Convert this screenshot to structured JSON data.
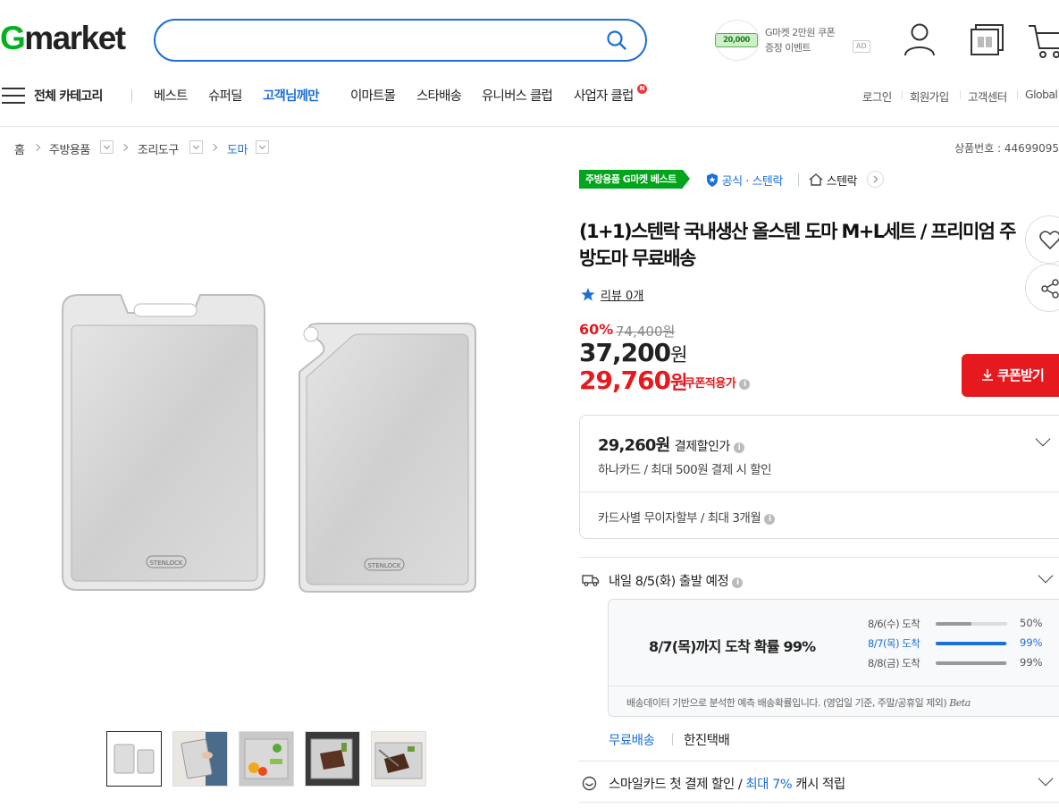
{
  "header": {
    "logo_g": "G",
    "logo_rest": "market",
    "search": {
      "value": "",
      "placeholder": ""
    },
    "ad": {
      "amount": "20,000",
      "line1": "G마켓 2만원 쿠폰",
      "line2": "증정 이벤트",
      "tag": "AD"
    },
    "icons": [
      "user-icon",
      "recent-items-icon",
      "cart-icon"
    ]
  },
  "nav": {
    "category_label": "전체 카테고리",
    "items": [
      {
        "label": "베스트",
        "highlight": false
      },
      {
        "label": "슈퍼딜",
        "highlight": false
      },
      {
        "label": "고객님께만",
        "highlight": true
      },
      {
        "label": "이마트몰",
        "highlight": false
      },
      {
        "label": "스타배송",
        "highlight": false
      },
      {
        "label": "유니버스 클럽",
        "highlight": false
      },
      {
        "label": "사업자 클럽",
        "highlight": false
      }
    ],
    "new_badge": "N",
    "utils": [
      "로그인",
      "회원가입",
      "고객센터",
      "Global"
    ]
  },
  "breadcrumb": {
    "items": [
      "홈",
      "주방용품",
      "조리도구",
      "도마"
    ],
    "product_no": "상품번호 : 44699095"
  },
  "gallery": {
    "brand_mark": "STENLOCK",
    "thumbnails": [
      "thumbnail-1",
      "thumbnail-2",
      "thumbnail-3",
      "thumbnail-4",
      "thumbnail-5"
    ],
    "selected_index": 0
  },
  "product": {
    "best_tag": "주방용품 G마켓 베스트",
    "official": "공식 · 스텐락",
    "store": "스텐락",
    "title": "(1+1)스텐락 국내생산 올스텐 도마 M+L세트 / 프리미엄 주방도마 무료배송",
    "review": "리뷰 0개",
    "discount": "60%",
    "original_price": "74,400원",
    "price_num": "37,200",
    "price_unit": "원",
    "coupon_price_num": "29,760",
    "coupon_price_unit": "원",
    "coupon_label": "쿠폰적용가",
    "coupon_button": "쿠폰받기"
  },
  "payment": {
    "amount": "29,260원",
    "amount_label": "결제할인가",
    "desc": "하나카드 / 최대 500원 결제 시 할인",
    "installment": "카드사별 무이자할부 / 최대 3개월"
  },
  "shipping": {
    "depart": "내일 8/5(화) 출발 예정",
    "headline": "8/7(목)까지 도착 확률 99%",
    "rows": [
      {
        "label": "8/6(수) 도착",
        "pct": "50%",
        "value": 0.5,
        "highlight": false
      },
      {
        "label": "8/7(목) 도착",
        "pct": "99%",
        "value": 0.99,
        "highlight": true
      },
      {
        "label": "8/8(금) 도착",
        "pct": "99%",
        "value": 0.99,
        "highlight": false
      }
    ],
    "note": "배송데이터 기반으로 분석한 예측 배송확률입니다. (영업일 기준, 주말/공휴일 제외)",
    "beta": "Beta",
    "free": "무료배송",
    "carrier": "한진택배"
  },
  "smile": {
    "prefix": "스마일카드 첫 결제 할인 / ",
    "highlight": "최대 7%",
    "suffix": " 캐시 적립"
  },
  "colors": {
    "brand_green": "#00b21c",
    "accent_blue": "#1c6fd6",
    "sale_red": "#e6191e"
  }
}
